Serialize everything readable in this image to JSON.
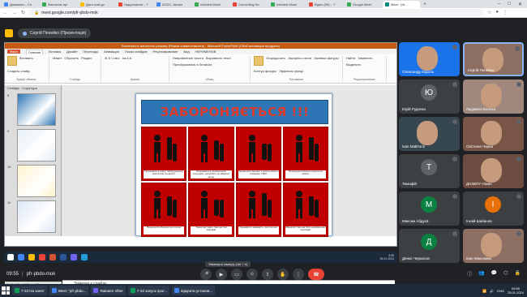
{
  "browser": {
    "tabs": [
      {
        "label": "Домашня – Сп",
        "color": "#4285f4"
      },
      {
        "label": "Фактичне прі",
        "color": "#34a853"
      },
      {
        "label": "Дати нові ур",
        "color": "#fbbc04"
      },
      {
        "label": "Надсилання – Т",
        "color": "#ea4335"
      },
      {
        "label": "ACDC. Автом",
        "color": "#4285f4"
      },
      {
        "label": "Infected Mush",
        "color": "#34a853"
      },
      {
        "label": "Converting Ho",
        "color": "#ea4335"
      },
      {
        "label": "Infected Mush",
        "color": "#34a853"
      },
      {
        "label": "Відео (59) – Y",
        "color": "#ea4335"
      },
      {
        "label": "Google Meet",
        "color": "#34a853"
      },
      {
        "label": "Meet: \"pfr-",
        "color": "#00897b",
        "active": true
      }
    ],
    "new_tab": "+",
    "url": "meet.google.com/pfr-pbdo-mok"
  },
  "presenter": {
    "label": "Сергій Пенейко (Презентація)"
  },
  "powerpoint": {
    "title": "Безпечність вагонного режиму (Режим совместимости) - Microsoft PowerPoint (Сбой активации продукта)",
    "menu": [
      "Файл",
      "Главная",
      "Вставка",
      "Дизайн",
      "Переходы",
      "Анимация",
      "Показ слайдов",
      "Рецензирование",
      "Вид",
      "НЕРИМЕНОВ"
    ],
    "ribbon_groups": [
      {
        "label": "Буфер обмена",
        "items": [
          "Вставить",
          "Создать слайд"
        ]
      },
      {
        "label": "Слайды",
        "items": [
          "Макет",
          "Сбросить",
          "Раздел"
        ]
      },
      {
        "label": "Шрифт",
        "items": [
          "Ж К Ч abc",
          "Aa A A"
        ]
      },
      {
        "label": "Абзац",
        "items": [
          "Направление текста",
          "Выровнять текст",
          "Преобразовать в SmartArt"
        ]
      },
      {
        "label": "Рисование",
        "items": [
          "Упорядочить",
          "Экспресс-стили",
          "Заливка фигуры",
          "Контур фигуры",
          "Эффекты фигур"
        ]
      },
      {
        "label": "Редактирование",
        "items": [
          "Найти",
          "Заменить",
          "Выделить"
        ]
      }
    ],
    "thumb_tabs": [
      "Слайды",
      "Структура"
    ],
    "thumbs": [
      {
        "num": "8"
      },
      {
        "num": "9"
      },
      {
        "num": "10"
      },
      {
        "num": "11"
      },
      {
        "num": "12"
      }
    ],
    "slide": {
      "heading": "ЗАБОРОНЯЄТЬСЯ !!!",
      "cells": [
        "Працювати в одягу, забрудненому мастилом, на висоті",
        "Працювати в промасленій спецодязі, допускати до зварних місць",
        "Перевозити балони з кисню разом з паливом, ГММ",
        "Перекидати балони кидати на землю",
        "Переносити балони на плечах",
        "Транспортувати балони без ковпаків",
        "Перевіряти наявність газу вогнем",
        "Зберігати балони біля нагрівальних приладів"
      ]
    },
    "notes": "Заметки к слайду",
    "status": "Слайд 12 из 16   Тема Office"
  },
  "inner_taskbar": {
    "time": "9:55",
    "date": "25.01.2024"
  },
  "tooltip": "Увімкнути камеру (ctrl + e)",
  "participants": [
    {
      "name": "Олександр Король",
      "type": "video",
      "color": "#1a73e8"
    },
    {
      "name": "Сергій Пенейко",
      "type": "video",
      "color": "#8d6e63",
      "highlight": true
    },
    {
      "name": "Юрій Руденко",
      "initial": "Ю",
      "color": "#5f6368"
    },
    {
      "name": "Людмила Волоха",
      "type": "video",
      "color": "#a1887f"
    },
    {
      "name": "Ivan Makhorin",
      "type": "video",
      "color": "#37474f"
    },
    {
      "name": "Світлана Чорна",
      "type": "video",
      "color": "#795548"
    },
    {
      "name": "Тимофій",
      "initial": "Т",
      "color": "#5f6368"
    },
    {
      "name": "ДНЗВПУ Ніжин",
      "type": "video",
      "color": "#6d4c41"
    },
    {
      "name": "Максим Абдуєв",
      "initial": "М",
      "color": "#0b8043"
    },
    {
      "name": "Ігнаій Шабанов",
      "initial": "І",
      "color": "#e8710a"
    },
    {
      "name": "Денис Черкасов",
      "initial": "Д",
      "color": "#0b8043"
    },
    {
      "name": "Іван Максимюк",
      "type": "video",
      "color": "#8d6e63"
    }
  ],
  "meeting": {
    "time": "09:55",
    "separator": "|",
    "code": "pfr-pbdo-mok"
  },
  "windows_taskbar": {
    "items": [
      {
        "label": "7-33 На занят",
        "color": "#0f9d58"
      },
      {
        "label": "Meet: \"pfr-pbdo...",
        "color": "#4285f4"
      },
      {
        "label": "Rakuten Viber",
        "color": "#7360f2"
      },
      {
        "label": "7-33 запуск прог...",
        "color": "#0f9d58"
      },
      {
        "label": "відкрити установ...",
        "color": "#4285f4"
      }
    ],
    "lang": "ENG",
    "time": "09:55",
    "date": "25.01.2024"
  }
}
